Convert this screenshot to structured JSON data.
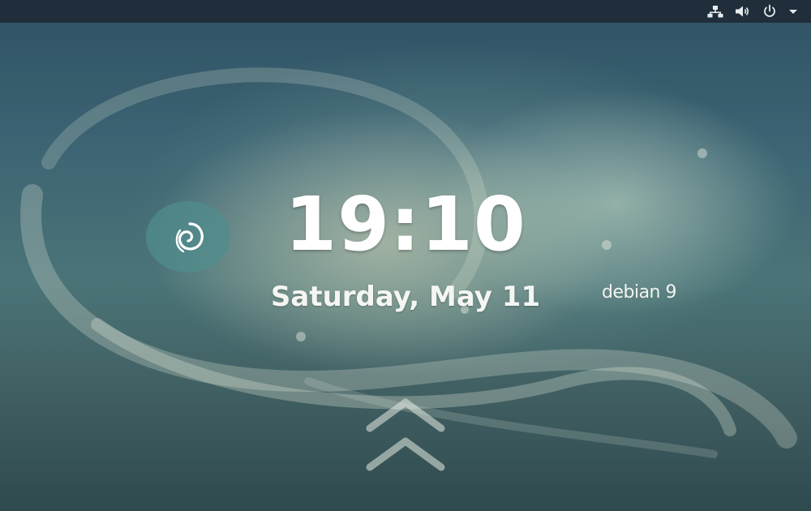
{
  "lockscreen": {
    "time": "19:10",
    "date": "Saturday, May 11",
    "brand": "debian 9"
  },
  "topbar": {
    "icons": [
      "network-icon",
      "volume-icon",
      "power-icon",
      "menu-arrow-icon"
    ]
  },
  "colors": {
    "topbar": "#1f2e3a",
    "logo_circle": "#508c8c",
    "text": "#ffffff"
  }
}
